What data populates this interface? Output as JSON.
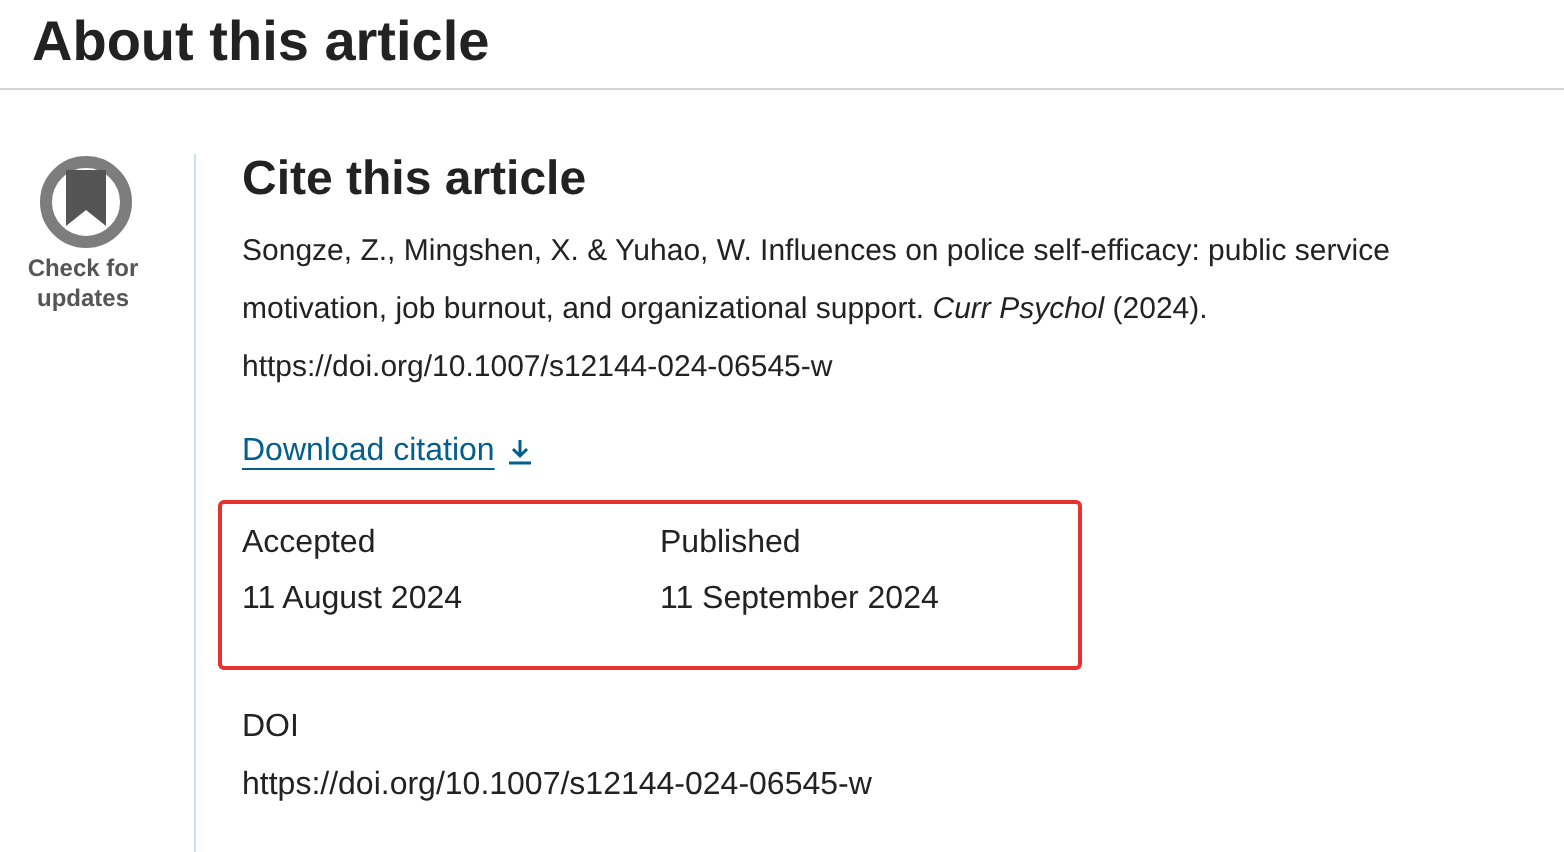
{
  "heading": "About this article",
  "badge": {
    "label": "Check for updates"
  },
  "cite": {
    "title": "Cite this article",
    "citation": "Songze, Z., Mingshen, X. & Yuhao, W. Influences on police self-efficacy: public service motivation, job burnout, and organizational support. *Curr Psychol* (2024). https://doi.org/10.1007/s12144-024-06545-w",
    "download": "Download citation"
  },
  "dates": [
    {
      "label": "Accepted",
      "value": "11 August 2024"
    },
    {
      "label": "Published",
      "value": "11 September 2024"
    }
  ],
  "doi": {
    "label": "DOI",
    "value": "https://doi.org/10.1007/s12144-024-06545-w"
  }
}
